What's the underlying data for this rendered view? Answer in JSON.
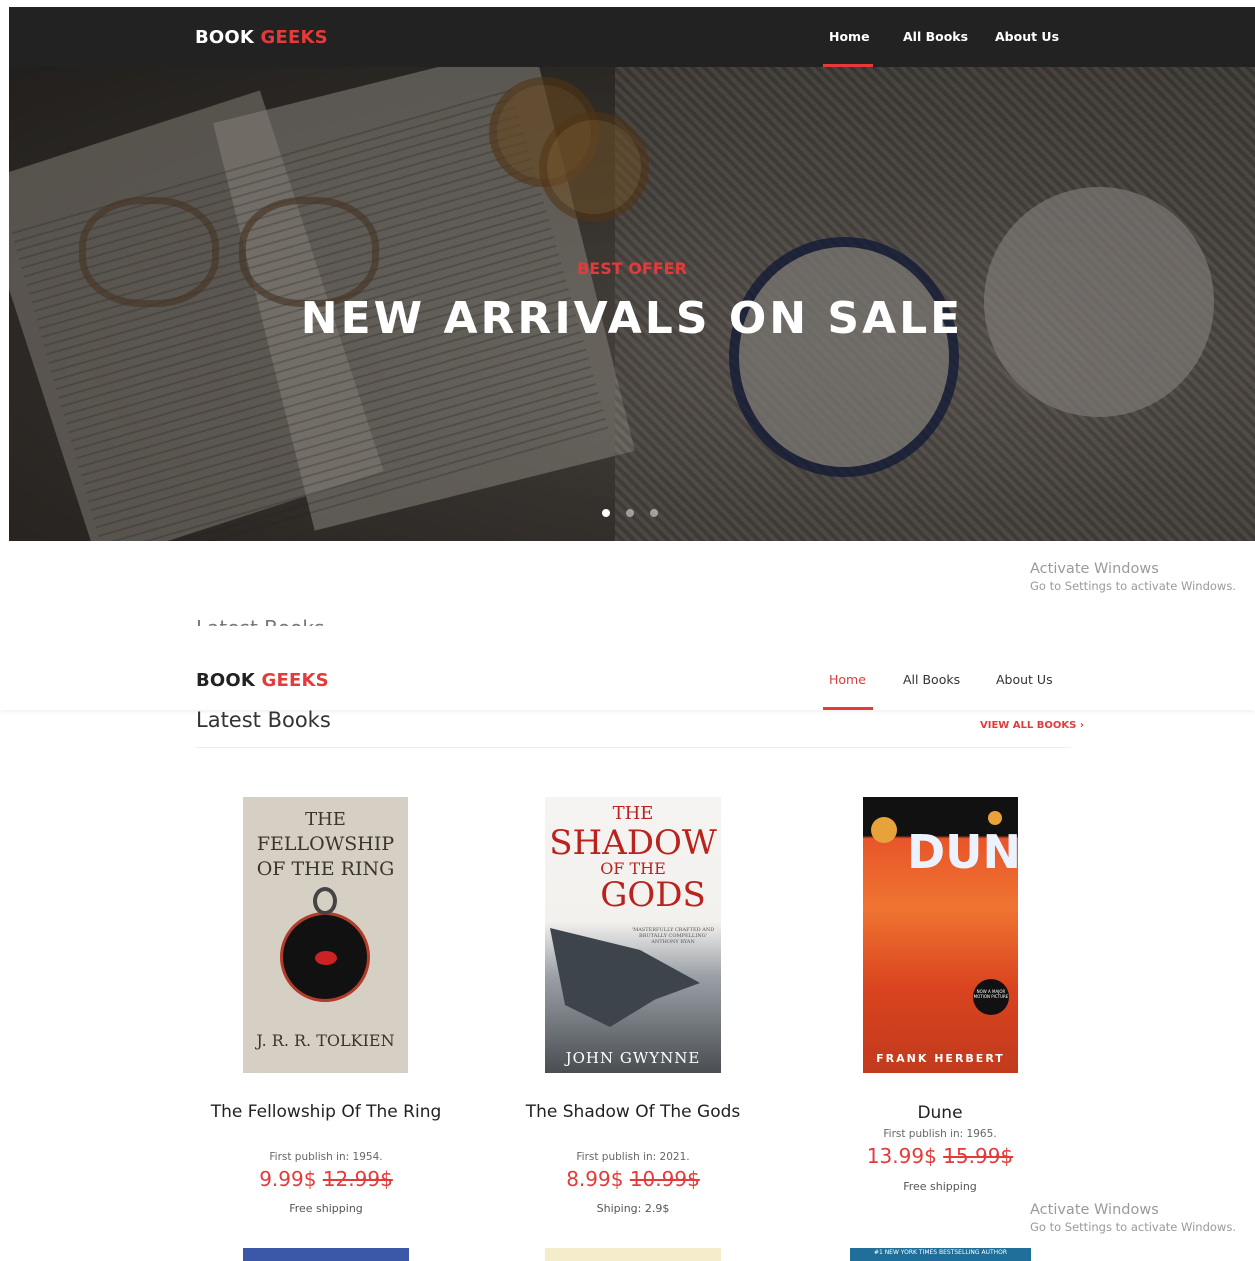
{
  "nav": {
    "brand_main": "BOOK",
    "brand_accent": "GEEKS",
    "links": [
      "Home",
      "All Books",
      "About Us"
    ],
    "active": "Home"
  },
  "hero": {
    "eyebrow": "BEST OFFER",
    "headline": "NEW ARRIVALS ON SALE",
    "slides": 3,
    "active_slide": 1
  },
  "watermark": {
    "line1": "Activate Windows",
    "line2": "Go to Settings to activate Windows."
  },
  "latest": {
    "title": "Latest Books",
    "view_all": "VIEW ALL BOOKS",
    "view_all_chevron": "›",
    "books": [
      {
        "title": "The Fellowship Of The Ring",
        "published": "First publish in: 1954.",
        "price": "9.99$",
        "old_price": "12.99$",
        "shipping": "Free shipping",
        "cover": {
          "line1": "THE",
          "line2": "FELLOWSHIP",
          "line3": "OF THE RING",
          "author": "J. R. R. TOLKIEN"
        }
      },
      {
        "title": "The Shadow Of The Gods",
        "published": "First publish in: 2021.",
        "price": "8.99$",
        "old_price": "10.99$",
        "shipping": "Shiping: 2.9$",
        "cover": {
          "line1": "THE",
          "line2": "SHADOW",
          "line3": "OF THE",
          "line4": "GODS",
          "quote": "'MASTERFULLY CRAFTED AND BRUTALLY COMPELLING' ANTHONY RYAN",
          "author": "JOHN GWYNNE"
        }
      },
      {
        "title": "Dune",
        "published": "First publish in: 1965.",
        "price": "13.99$",
        "old_price": "15.99$",
        "shipping": "Free shipping",
        "cover": {
          "word": "DUNE",
          "badge": "NOW A MAJOR MOTION PICTURE",
          "author": "FRANK HERBERT"
        }
      }
    ],
    "peek_text": "#1 NEW YORK TIMES BESTSELLING AUTHOR"
  },
  "colors": {
    "accent": "#e53a3a",
    "nav_dark": "#222222"
  }
}
